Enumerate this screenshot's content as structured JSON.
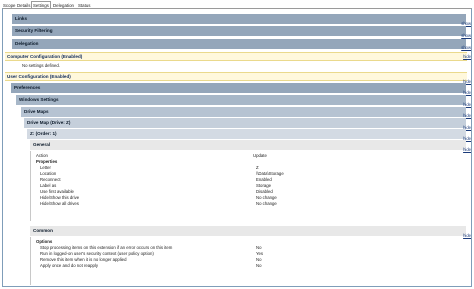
{
  "tabs": [
    "Scope",
    "Details",
    "Settings",
    "Delegation",
    "Status"
  ],
  "active_tab": "Settings",
  "links": {
    "show": "show",
    "hide": "hide"
  },
  "sections": {
    "links": "Links",
    "security_filtering": "Security Filtering",
    "delegation": "Delegation",
    "computer_config": "Computer Configuration (Enabled)",
    "no_settings": "No settings defined.",
    "user_config": "User Configuration (Enabled)",
    "preferences": "Preferences",
    "windows_settings": "Windows Settings",
    "drive_maps": "Drive Maps",
    "drive_map": "Drive Map (Drive: Z)",
    "z_order": "Z: (Order: 1)",
    "general": "General",
    "common": "Common"
  },
  "general": {
    "action_label": "Action",
    "action_value": "Update",
    "properties_header": "Properties",
    "rows": [
      {
        "label": "Letter",
        "value": "Z"
      },
      {
        "label": "Location",
        "value": "\\\\Data\\Storage"
      },
      {
        "label": "Reconnect",
        "value": "Enabled"
      },
      {
        "label": "Label as",
        "value": "Storage"
      },
      {
        "label": "Use first available",
        "value": "Disabled"
      },
      {
        "label": "Hide/Show this drive",
        "value": "No change"
      },
      {
        "label": "Hide/Show all drives",
        "value": "No change"
      }
    ]
  },
  "common": {
    "options_header": "Options",
    "rows": [
      {
        "label": "Stop processing items on this extension if an error occurs on this item",
        "value": "No"
      },
      {
        "label": "Run in logged-on user's security context (user policy option)",
        "value": "Yes"
      },
      {
        "label": "Remove this item when it is no longer applied",
        "value": "No"
      },
      {
        "label": "Apply once and do not reapply",
        "value": "No"
      }
    ]
  }
}
